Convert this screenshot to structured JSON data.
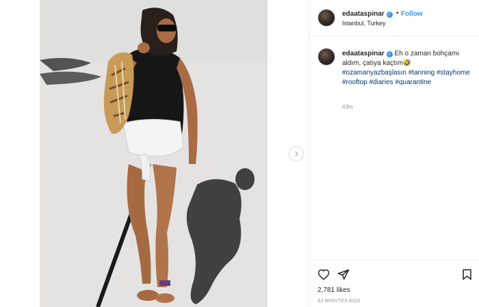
{
  "post": {
    "username": "edaataspinar",
    "verified_glyph": "✓",
    "separator": "•",
    "follow_label": "Follow",
    "location": "Istanbul, Turkey",
    "caption_text": "Eh o zaman bohçamı aldım, çatıya kaçtım",
    "caption_emoji": "🤣",
    "hashtags": [
      "#ozamanyazbaşlasın",
      "#tanning",
      "#stayhome",
      "#rooftop",
      "#diaries",
      "#quarantine"
    ],
    "caption_age": "43m",
    "likes": "2,781 likes",
    "posted_ago": "43 MINUTES AGO"
  },
  "icons": {
    "next": "chevron-right-icon",
    "like": "heart-icon",
    "share": "paper-plane-icon",
    "save": "bookmark-icon"
  },
  "colors": {
    "link": "#3897f0",
    "hashtag": "#00376b",
    "muted": "#8e8e8e",
    "border": "#efefef"
  }
}
